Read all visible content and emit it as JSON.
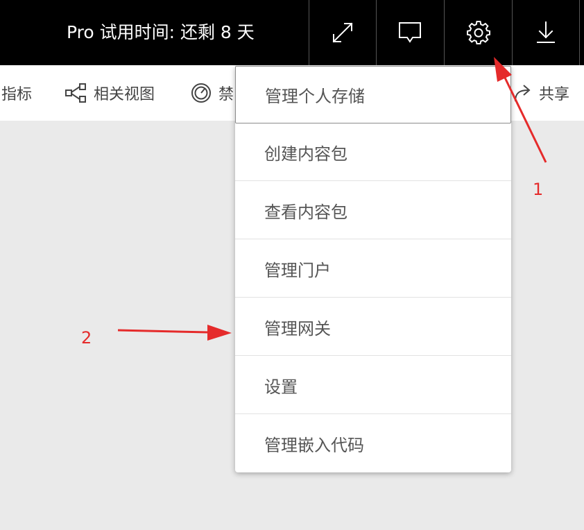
{
  "topbar": {
    "trial_text": "Pro 试用时间: 还剩 8 天",
    "buttons": [
      {
        "icon": "fullscreen-icon"
      },
      {
        "icon": "comment-icon"
      },
      {
        "icon": "gear-icon"
      },
      {
        "icon": "download-icon"
      }
    ]
  },
  "actionbar": {
    "items": [
      {
        "label": "指标",
        "icon": ""
      },
      {
        "label": "相关视图",
        "icon": "related-view-icon"
      },
      {
        "label": "禁",
        "icon": "gauge-icon"
      },
      {
        "label": "共享",
        "icon": "share-icon"
      }
    ]
  },
  "menu": {
    "items": [
      {
        "label": "管理个人存储"
      },
      {
        "label": "创建内容包"
      },
      {
        "label": "查看内容包"
      },
      {
        "label": "管理门户"
      },
      {
        "label": "管理网关"
      },
      {
        "label": "设置"
      },
      {
        "label": "管理嵌入代码"
      }
    ]
  },
  "annotations": {
    "label_1": "1",
    "label_2": "2",
    "color": "#e52b2b"
  },
  "colors": {
    "topbar_bg": "#000000",
    "page_bg": "#eaeaea",
    "menu_text": "#555555"
  }
}
